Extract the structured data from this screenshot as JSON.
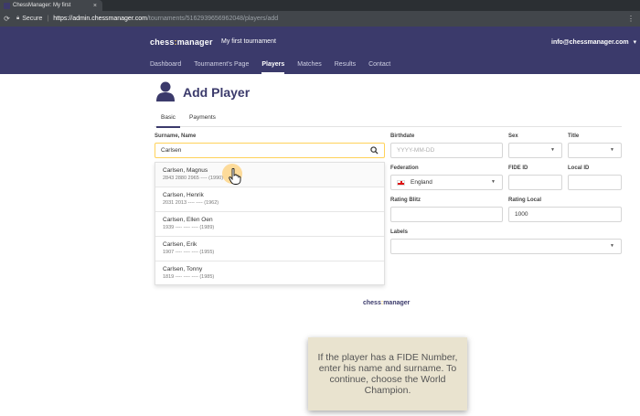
{
  "browser": {
    "tab_title": "ChessManager: My first",
    "tab_close": "×",
    "secure_label": "Secure",
    "url_host": "https://admin.chessmanager.com",
    "url_path": "/tournaments/5162939656962048/players/add"
  },
  "header": {
    "brand_part1": "chess",
    "brand_part2": "manager",
    "tournament": "My first tournament",
    "user": "info@chessmanager.com"
  },
  "nav": [
    {
      "label": "Dashboard"
    },
    {
      "label": "Tournament's Page"
    },
    {
      "label": "Players"
    },
    {
      "label": "Matches"
    },
    {
      "label": "Results"
    },
    {
      "label": "Contact"
    }
  ],
  "page": {
    "title": "Add Player"
  },
  "tabs": [
    {
      "label": "Basic"
    },
    {
      "label": "Payments"
    }
  ],
  "form": {
    "surname_label": "Surname, Name",
    "surname_value": "Carlsen",
    "birthdate_label": "Birthdate",
    "birthdate_placeholder": "YYYY-MM-DD",
    "sex_label": "Sex",
    "title_label": "Title",
    "federation_label": "Federation",
    "federation_value": "England",
    "fide_label": "FIDE ID",
    "local_id_label": "Local ID",
    "rating_blitz_label": "Rating Blitz",
    "rating_local_label": "Rating Local",
    "rating_local_value": "1000",
    "labels_label": "Labels"
  },
  "suggestions": [
    {
      "name": "Carlsen, Magnus",
      "details": "2843 2880 2965 ---- (1990)"
    },
    {
      "name": "Carlsen, Henrik",
      "details": "2031 2013 ---- ---- (1962)"
    },
    {
      "name": "Carlsen, Ellen Oen",
      "details": "1939 ---- ---- ---- (1989)"
    },
    {
      "name": "Carlsen, Erik",
      "details": "1907 ---- ---- ---- (1955)"
    },
    {
      "name": "Carlsen, Tonny",
      "details": "1819 ---- ---- ---- (1985)"
    }
  ],
  "footer": {
    "brand_part1": "chess",
    "brand_part2": "manager"
  },
  "tooltip": "If the player has a FIDE Number, enter his name and surname. To continue, choose the World Champion.",
  "colors": {
    "header_bg": "#3b3a6b",
    "accent": "#ffd25a",
    "tooltip_bg": "#e9e3cf"
  }
}
